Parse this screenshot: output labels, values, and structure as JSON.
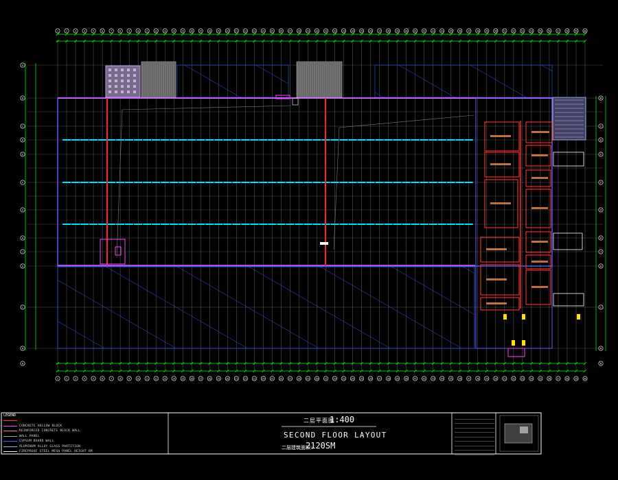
{
  "drawing": {
    "grid_x_bubbles": [
      "1",
      "2",
      "3",
      "4",
      "5",
      "6",
      "7",
      "8",
      "9",
      "10",
      "11",
      "12",
      "13",
      "14",
      "15",
      "16",
      "17",
      "18",
      "19",
      "20",
      "21",
      "22",
      "23",
      "24",
      "25",
      "26",
      "27",
      "28",
      "29",
      "30",
      "31",
      "32",
      "33",
      "34",
      "35",
      "36",
      "37",
      "38",
      "39",
      "40",
      "41",
      "42",
      "43",
      "44",
      "45",
      "46",
      "47",
      "48",
      "49",
      "50",
      "51",
      "52",
      "53",
      "54",
      "55",
      "56",
      "57",
      "58",
      "59",
      "60"
    ],
    "grid_y_bubbles": [
      "A",
      "B",
      "C",
      "D",
      "E",
      "F",
      "G",
      "H",
      "J",
      "K",
      "L",
      "M",
      "N"
    ],
    "legend": {
      "title": "LEGEND",
      "items": [
        {
          "label": "",
          "color": "#ff4040"
        },
        {
          "label": "CONCRETE HOLLOW BLOCK",
          "color": "#ff40ff"
        },
        {
          "label": "REINFORCED CONCRETE BLOCK WALL",
          "color": "#ff8080"
        },
        {
          "label": "WALL PANEL",
          "color": "#a0a0a0"
        },
        {
          "label": "GYPSUM BOARD WALL",
          "color": "#4060ff"
        },
        {
          "label": "ALUMINUM ALLOY GLASS PARTITION",
          "color": "#80c0ff"
        },
        {
          "label": "FIREPROOF STEEL MESH PANEL HEIGHT 6M",
          "color": "#ffffff"
        }
      ]
    },
    "title_block": {
      "title_cn": "二层平面图",
      "scale": "1:400",
      "title_en": "SECOND FLOOR LAYOUT",
      "area_cn": "二层建筑面积:",
      "area": "2120SM"
    },
    "colors": {
      "background": "#000000",
      "grid": "#ffffff",
      "dimension": "#00ff00",
      "wall": "#6060ff",
      "column_line": "#ff2020",
      "hatch": "#3050d0",
      "partition": "#ff40ff",
      "cyan_beam": "#00e0ff",
      "brown_text": "#c07040"
    }
  }
}
